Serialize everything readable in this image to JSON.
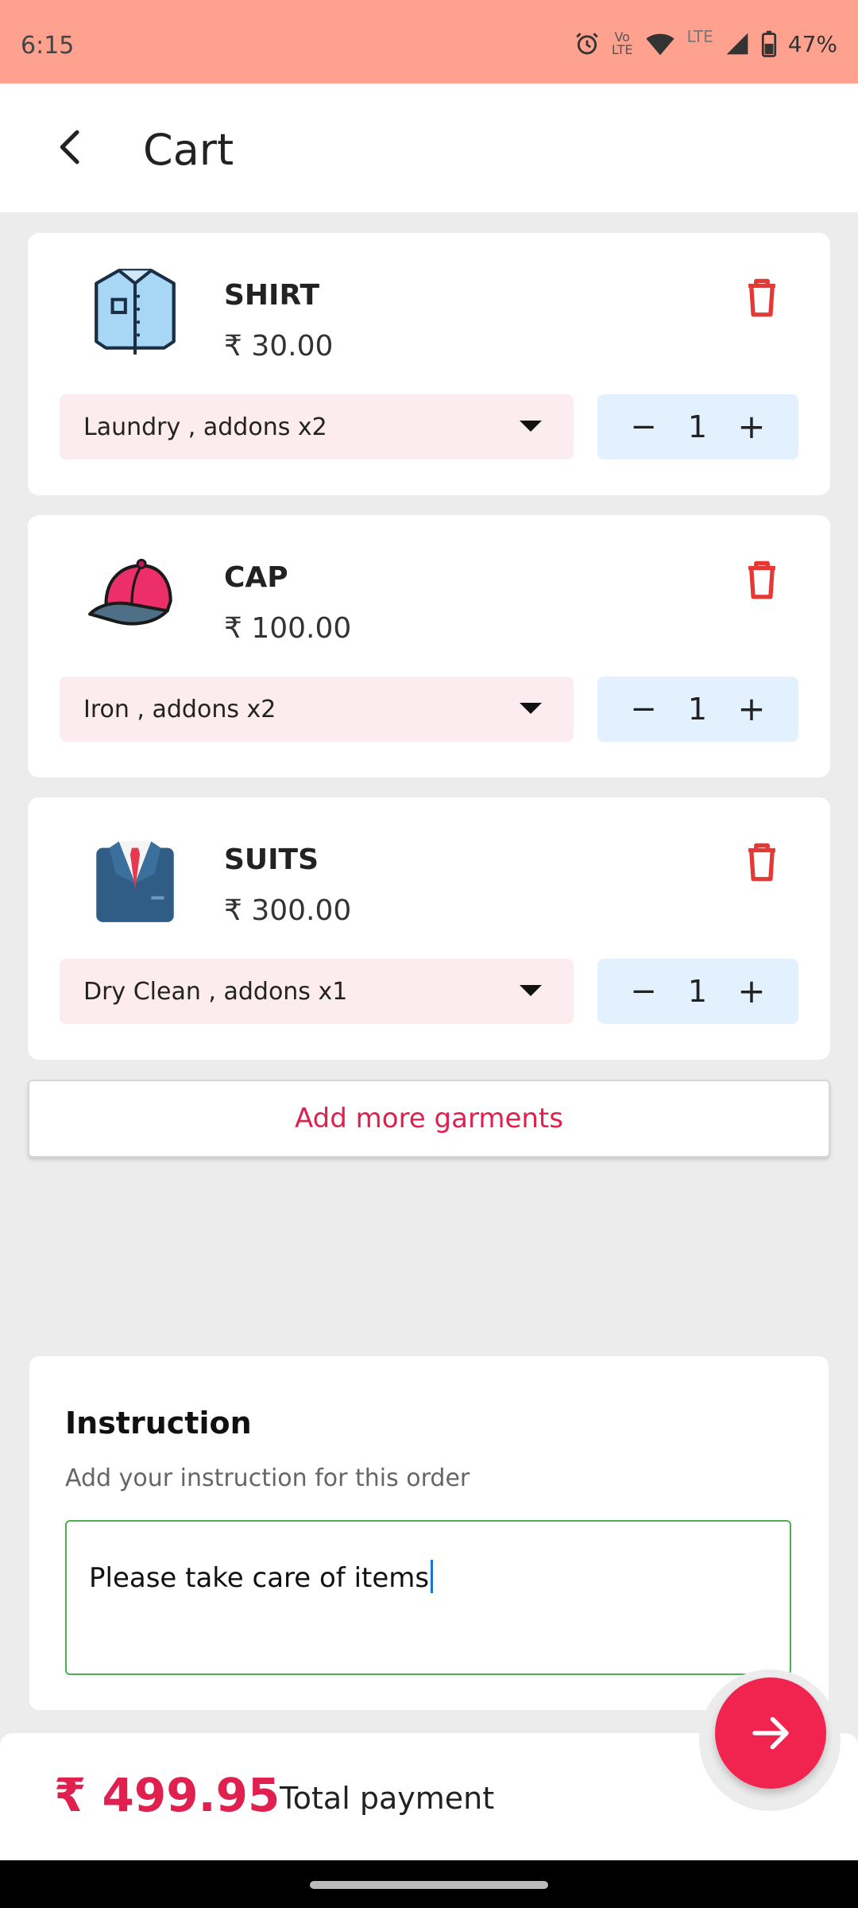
{
  "status_bar": {
    "time": "6:15",
    "volte_top": "Vo",
    "volte_bottom": "LTE",
    "lte": "LTE",
    "battery": "47%"
  },
  "header": {
    "title": "Cart"
  },
  "cart_items": [
    {
      "name": "SHIRT",
      "price": "₹ 30.00",
      "service": "Laundry , addons x2",
      "quantity": "1",
      "icon": "shirt-icon"
    },
    {
      "name": "CAP",
      "price": "₹ 100.00",
      "service": "Iron , addons x2",
      "quantity": "1",
      "icon": "cap-icon"
    },
    {
      "name": "SUITS",
      "price": "₹ 300.00",
      "service": "Dry Clean , addons x1",
      "quantity": "1",
      "icon": "suit-icon"
    }
  ],
  "stepper": {
    "minus": "−",
    "plus": "+"
  },
  "add_more_label": "Add more garments",
  "instruction": {
    "heading": "Instruction",
    "subtitle": "Add your instruction for this order",
    "value": "Please take care of items"
  },
  "footer": {
    "total": "₹ 499.95",
    "total_label": "Total payment"
  },
  "colors": {
    "status_bar": "#ffa18f",
    "accent": "#f0244f",
    "dropdown_bg": "#fdecef",
    "stepper_bg": "#e2f1fd",
    "focus_border": "#4caf50"
  }
}
